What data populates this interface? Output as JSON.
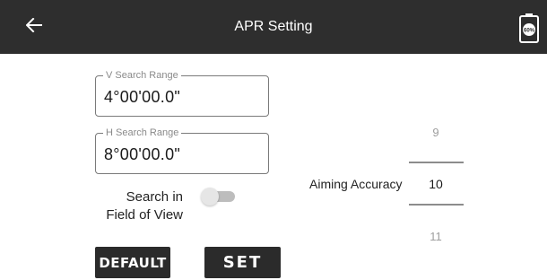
{
  "header": {
    "title": "APR Setting",
    "back_icon": "arrow-left-icon",
    "battery_icon": "battery-icon",
    "battery_level": "60%"
  },
  "v_search": {
    "label": "V Search Range",
    "value": "4°00'00.0\""
  },
  "h_search": {
    "label": "H Search Range",
    "value": "8°00'00.0\""
  },
  "fov": {
    "label_line1": "Search in",
    "label_line2": "Field of View",
    "enabled": false
  },
  "aiming": {
    "label": "Aiming Accuracy",
    "prev": "9",
    "selected": "10",
    "next": "11"
  },
  "buttons": {
    "default_label": "DEFAULT",
    "set_label": "SET"
  },
  "colors": {
    "header_bg": "#2e2e2e",
    "button_bg": "#2b2b2b",
    "toggle_off": "#bdbdbd"
  }
}
